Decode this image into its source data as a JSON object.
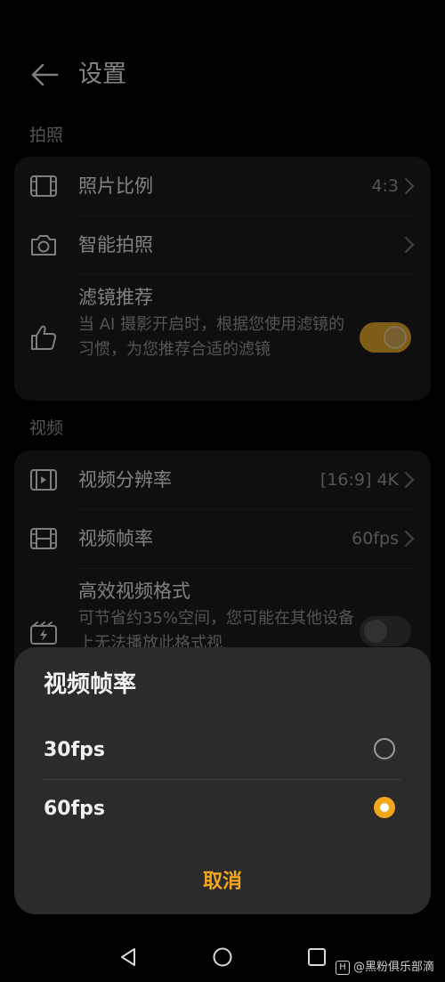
{
  "header": {
    "title": "设置",
    "back_icon": "arrow-left-icon"
  },
  "photo_section": {
    "label": "拍照",
    "rows": [
      {
        "label": "照片比例",
        "value": "4:3",
        "icon": "aspect-ratio-icon"
      },
      {
        "label": "智能拍照",
        "value": "",
        "icon": "camera-icon"
      },
      {
        "label": "滤镜推荐",
        "subtitle": "当 AI 摄影开启时，根据您使用滤镜的习惯，为您推荐合适的滤镜",
        "icon": "thumbs-up-icon",
        "toggle": true
      }
    ]
  },
  "video_section": {
    "label": "视频",
    "rows": [
      {
        "label": "视频分辨率",
        "value": "[16:9] 4K",
        "icon": "video-resolution-icon"
      },
      {
        "label": "视频帧率",
        "value": "60fps",
        "icon": "film-strip-icon"
      },
      {
        "label": "高效视频格式",
        "subtitle": "可节省约35%空间，您可能在其他设备上无法播放此格式视",
        "icon": "efficient-format-icon",
        "toggle": false
      }
    ]
  },
  "dialog": {
    "title": "视频帧率",
    "options": [
      {
        "label": "30fps",
        "selected": false
      },
      {
        "label": "60fps",
        "selected": true
      }
    ],
    "cancel_label": "取消"
  },
  "watermark": {
    "badge": "H",
    "text": "@黑粉俱乐部滴"
  },
  "colors": {
    "accent": "#f2a81d",
    "card": "#1c1c1c",
    "sheet": "#2b2b2b"
  }
}
